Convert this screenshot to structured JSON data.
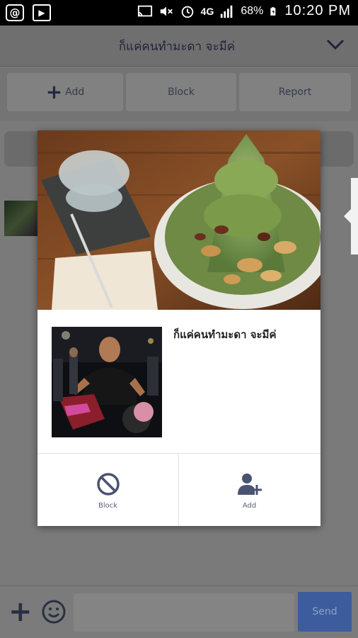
{
  "status_bar": {
    "network": "4G",
    "battery": "68%",
    "time": "10:20 PM",
    "icons": [
      "at-icon",
      "screenshot-icon",
      "cast-icon",
      "mute-icon",
      "alarm-icon",
      "signal-icon",
      "battery-icon"
    ]
  },
  "chat_header": {
    "title": "ก็แค่คนทำมะดา จะมีค่",
    "chevron_icon": "chevron-down-icon"
  },
  "action_bar": {
    "add_label": "Add",
    "block_label": "Block",
    "report_label": "Report"
  },
  "modal": {
    "profile_name": "ก็แค่คนทำมะดา จะมีค่",
    "block_label": "Block",
    "add_label": "Add",
    "block_icon": "block-icon",
    "add_icon": "add-friend-icon"
  },
  "input_bar": {
    "send_label": "Send",
    "plus_icon": "plus-icon",
    "emoji_icon": "smiley-icon"
  },
  "colors": {
    "accent": "#3c5c9e",
    "icon_color": "#4a5371"
  }
}
